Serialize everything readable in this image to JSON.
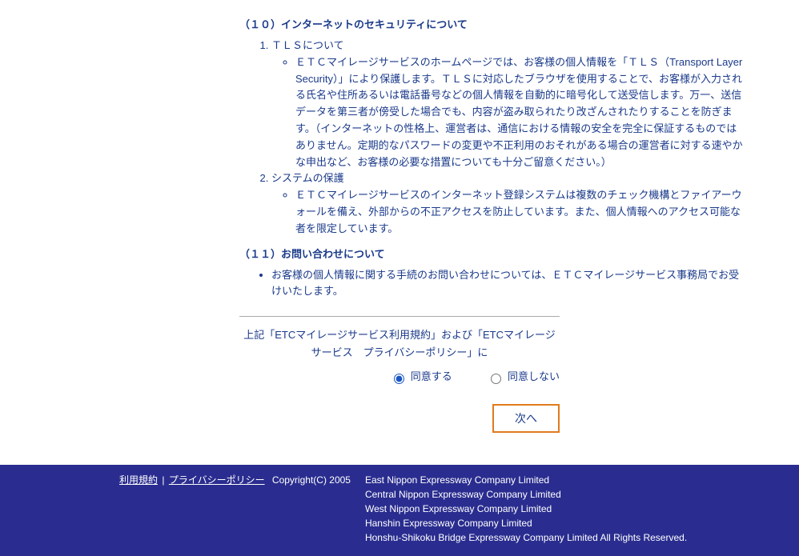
{
  "sections": {
    "s10": {
      "title": "（１０）インターネットのセキュリティについて",
      "items": [
        {
          "label": "ＴＬＳについて",
          "body": "ＥＴＣマイレージサービスのホームページでは、お客様の個人情報を「ＴＬＳ（Transport Layer Security）」により保護します。ＴＬＳに対応したブラウザを使用することで、お客様が入力される氏名や住所あるいは電話番号などの個人情報を自動的に暗号化して送受信します。万一、送信データを第三者が傍受した場合でも、内容が盗み取られたり改ざんされたりすることを防ぎます。（インターネットの性格上、運営者は、通信における情報の安全を完全に保証するものではありません。定期的なパスワードの変更や不正利用のおそれがある場合の運営者に対する速やかな申出など、お客様の必要な措置についても十分ご留意ください。）"
        },
        {
          "label": "システムの保護",
          "body": "ＥＴＣマイレージサービスのインターネット登録システムは複数のチェック機構とファイアーウォールを備え、外部からの不正アクセスを防止しています。また、個人情報へのアクセス可能な者を限定しています。"
        }
      ]
    },
    "s11": {
      "title": "（１１）お問い合わせについて",
      "body": "お客様の個人情報に関する手続のお問い合わせについては、ＥＴＣマイレージサービス事務局でお受けいたします。"
    }
  },
  "consent": {
    "prompt": "上記「ETCマイレージサービス利用規約」および「ETCマイレージサービス　プライバシーポリシー」に",
    "agree": "同意する",
    "disagree": "同意しない"
  },
  "buttons": {
    "next": "次へ"
  },
  "footer": {
    "terms": "利用規約",
    "privacy": "プライバシーポリシー",
    "copyright": "Copyright(C) 2005",
    "companies": [
      "East Nippon Expressway Company Limited",
      "Central Nippon Expressway Company Limited",
      "West Nippon Expressway Company Limited",
      "Hanshin Expressway Company Limited",
      "Honshu-Shikoku Bridge Expressway Company Limited All Rights Reserved."
    ]
  }
}
